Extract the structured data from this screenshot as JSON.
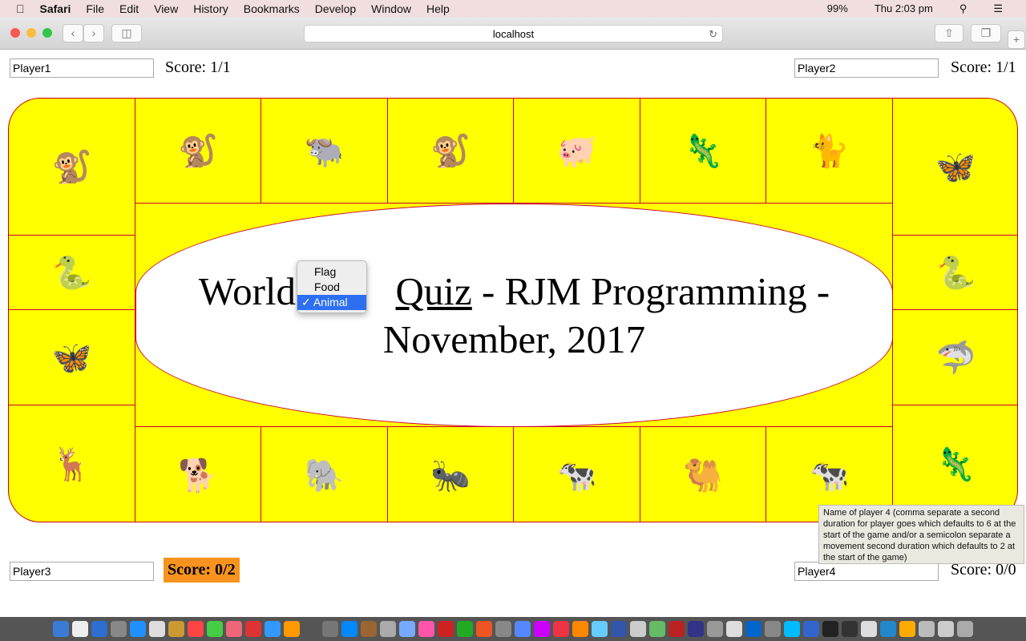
{
  "menubar": {
    "app": "Safari",
    "items": [
      "File",
      "Edit",
      "View",
      "History",
      "Bookmarks",
      "Develop",
      "Window",
      "Help"
    ],
    "battery": "99%",
    "clock": "Thu 2:03 pm"
  },
  "browser": {
    "url": "localhost"
  },
  "players": [
    {
      "name": "Player1",
      "score": "Score: 1/1"
    },
    {
      "name": "Player2",
      "score": "Score: 1/1"
    },
    {
      "name": "Player3",
      "score": "Score: 0/2"
    },
    {
      "name": "Player4",
      "score": "Score: 0/0"
    }
  ],
  "title": {
    "before": "World",
    "link": "Quiz",
    "after": " - RJM Programming - November, 2017"
  },
  "category_select": {
    "options": [
      "Flag",
      "Food",
      "Animal"
    ],
    "selected": "Animal"
  },
  "board": {
    "top": [
      "🐒",
      "🐒",
      "🐃",
      "🐒",
      "🐖",
      "🦎",
      "🐈",
      "🦋"
    ],
    "left": [
      "🐍",
      "🦋"
    ],
    "right": [
      "🐍",
      "🦈"
    ],
    "bottom": [
      "🦌",
      "🐕",
      "🐘",
      "🐜",
      "🐄",
      "🐫",
      "🐄",
      "🦎"
    ]
  },
  "tooltip": "Name of player 4 (comma separate a second duration for player goes which defaults to 6 at the start of the game and/or a semicolon separate a movement second duration which defaults to 2 at the start of the game)",
  "colors": {
    "board": "#ffff00",
    "border": "#cc0033",
    "active_score": "#f7931e"
  }
}
